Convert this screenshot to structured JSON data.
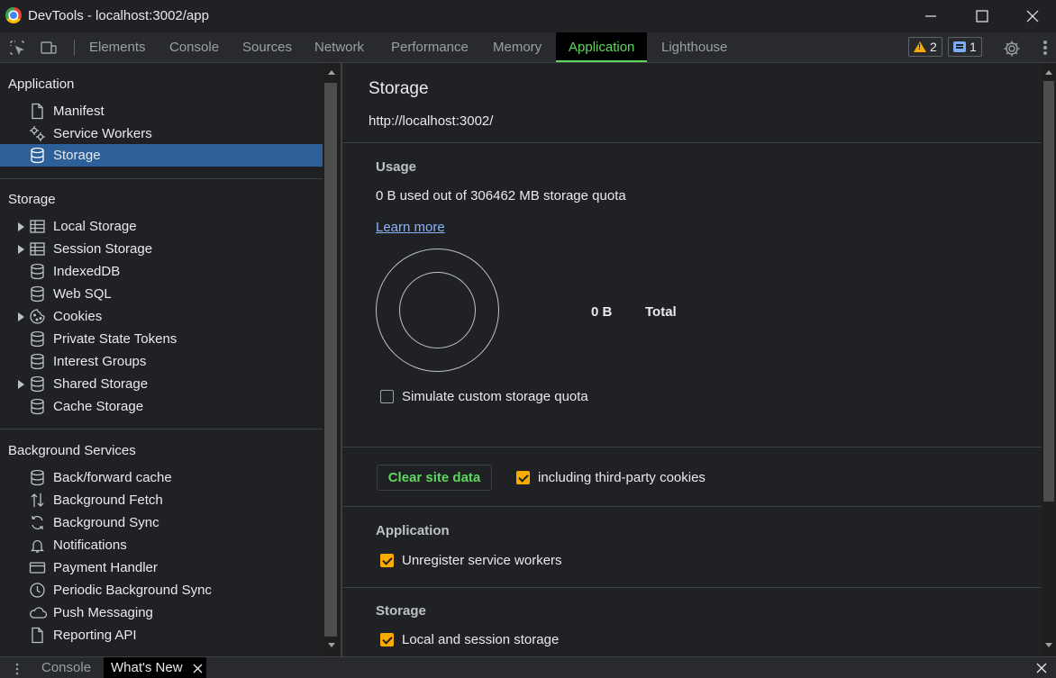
{
  "window": {
    "title": "DevTools - localhost:3002/app"
  },
  "toolbar": {
    "tabs": [
      {
        "label": "Elements"
      },
      {
        "label": "Console"
      },
      {
        "label": "Sources"
      },
      {
        "label": "Network"
      },
      {
        "label": "Performance"
      },
      {
        "label": "Memory"
      },
      {
        "label": "Application",
        "active": true
      },
      {
        "label": "Lighthouse"
      }
    ],
    "warnings_count": "2",
    "messages_count": "1"
  },
  "sidebar": {
    "application": {
      "title": "Application",
      "items": [
        {
          "label": "Manifest",
          "icon": "document-icon"
        },
        {
          "label": "Service Workers",
          "icon": "gears-icon"
        },
        {
          "label": "Storage",
          "icon": "database-icon",
          "selected": true
        }
      ]
    },
    "storage": {
      "title": "Storage",
      "items": [
        {
          "label": "Local Storage",
          "icon": "table-icon",
          "expandable": true
        },
        {
          "label": "Session Storage",
          "icon": "table-icon",
          "expandable": true
        },
        {
          "label": "IndexedDB",
          "icon": "database-icon"
        },
        {
          "label": "Web SQL",
          "icon": "database-icon"
        },
        {
          "label": "Cookies",
          "icon": "cookie-icon",
          "expandable": true
        },
        {
          "label": "Private State Tokens",
          "icon": "database-icon"
        },
        {
          "label": "Interest Groups",
          "icon": "database-icon"
        },
        {
          "label": "Shared Storage",
          "icon": "database-icon",
          "expandable": true
        },
        {
          "label": "Cache Storage",
          "icon": "database-icon"
        }
      ]
    },
    "background": {
      "title": "Background Services",
      "items": [
        {
          "label": "Back/forward cache",
          "icon": "database-icon"
        },
        {
          "label": "Background Fetch",
          "icon": "up-down-arrows-icon"
        },
        {
          "label": "Background Sync",
          "icon": "sync-icon"
        },
        {
          "label": "Notifications",
          "icon": "bell-icon"
        },
        {
          "label": "Payment Handler",
          "icon": "card-icon"
        },
        {
          "label": "Periodic Background Sync",
          "icon": "clock-icon"
        },
        {
          "label": "Push Messaging",
          "icon": "cloud-icon"
        },
        {
          "label": "Reporting API",
          "icon": "document-icon"
        }
      ]
    }
  },
  "main": {
    "title": "Storage",
    "origin": "http://localhost:3002/",
    "usage": {
      "heading": "Usage",
      "text": "0 B used out of 306462 MB storage quota",
      "learn_more": "Learn more",
      "total_value": "0 B",
      "total_label": "Total",
      "simulate_label": "Simulate custom storage quota",
      "simulate_checked": false
    },
    "clear": {
      "button_label": "Clear site data",
      "third_party_label": "including third-party cookies",
      "third_party_checked": true
    },
    "application_section": {
      "heading": "Application",
      "unregister_label": "Unregister service workers",
      "unregister_checked": true
    },
    "storage_section": {
      "heading": "Storage",
      "local_session_label": "Local and session storage",
      "local_session_checked": true
    }
  },
  "drawer": {
    "tabs": [
      {
        "label": "Console"
      },
      {
        "label": "What's New",
        "active": true
      }
    ]
  },
  "colors": {
    "accent_green": "#5cd85c",
    "checkbox_orange": "#f9ab00",
    "selected_blue": "#2d5f98",
    "link_blue": "#8ab4f8"
  }
}
